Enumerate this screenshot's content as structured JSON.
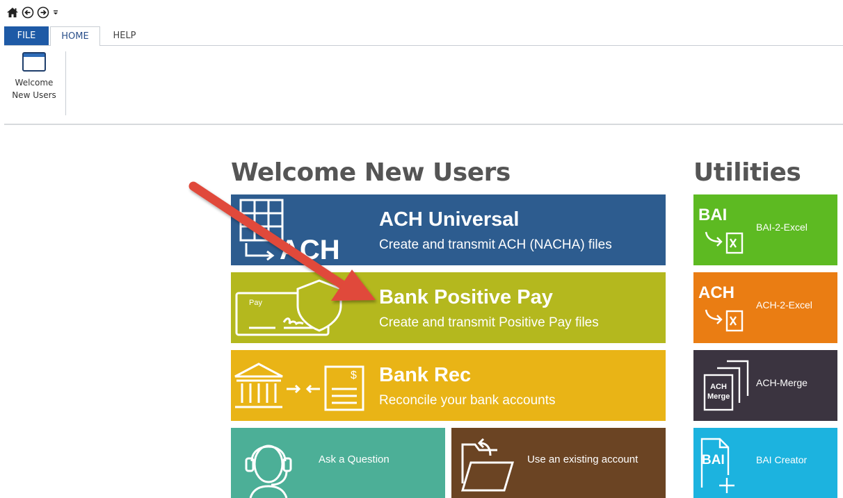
{
  "ribbon": {
    "tabs": [
      "FILE",
      "HOME",
      "HELP"
    ],
    "welcome_button": {
      "line1": "Welcome",
      "line2": "New Users"
    }
  },
  "sections": {
    "welcome_title": "Welcome New Users",
    "utilities_title": "Utilities"
  },
  "tiles": {
    "ach": {
      "icon_text": "ACH",
      "title": "ACH Universal",
      "subtitle": "Create and transmit ACH (NACHA) files",
      "color": "#2d5c8f"
    },
    "pospay": {
      "icon_text": "Pay",
      "title": "Bank Positive Pay",
      "subtitle": "Create and transmit Positive Pay files",
      "color": "#b4b81e"
    },
    "bankrec": {
      "icon_text": "$",
      "title": "Bank Rec",
      "subtitle": "Reconcile your bank accounts",
      "color": "#e9b416"
    },
    "ask": {
      "label": "Ask a Question",
      "color": "#4caf97"
    },
    "existing": {
      "label": "Use an existing account",
      "color": "#6b4423"
    }
  },
  "utilities": {
    "bai2excel": {
      "badge": "BAI",
      "label": "BAI-2-Excel",
      "color": "#5dba22"
    },
    "ach2excel": {
      "badge": "ACH",
      "label": "ACH-2-Excel",
      "color": "#ea7d13"
    },
    "achmerge": {
      "badge_line1": "ACH",
      "badge_line2": "Merge",
      "label": "ACH-Merge",
      "color": "#3b3440"
    },
    "baicreator": {
      "badge": "BAI",
      "label": "BAI Creator",
      "color": "#1cb3df"
    }
  },
  "colors": {
    "arrow": "#e04a3a",
    "file_tab": "#1e5aa6"
  }
}
